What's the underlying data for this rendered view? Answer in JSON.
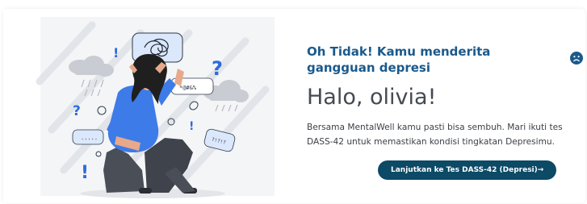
{
  "result": {
    "headline": "Oh Tidak! Kamu menderita gangguan depresi",
    "greeting": "Halo, olivia!",
    "description": "Bersama MentalWell kamu pasti bisa sembuh. Mari ikuti tes DASS-42 untuk memastikan kondisi tingkatan Depresimu.",
    "cta_label": "Lanjutkan ke Tes DASS-42 (Depresi)→",
    "status_icon": "sad-face-icon"
  },
  "illustration": {
    "subject": "stressed-woman-illustration",
    "scribbles": [
      "!",
      "?",
      "!",
      "?",
      "*@#&%",
      "!",
      "?!?!?"
    ]
  },
  "colors": {
    "accent": "#1a5a8c",
    "button": "#0c4a66",
    "shirt": "#3d7be8",
    "pants": "#4a4e57",
    "hair": "#1f1f1f"
  }
}
